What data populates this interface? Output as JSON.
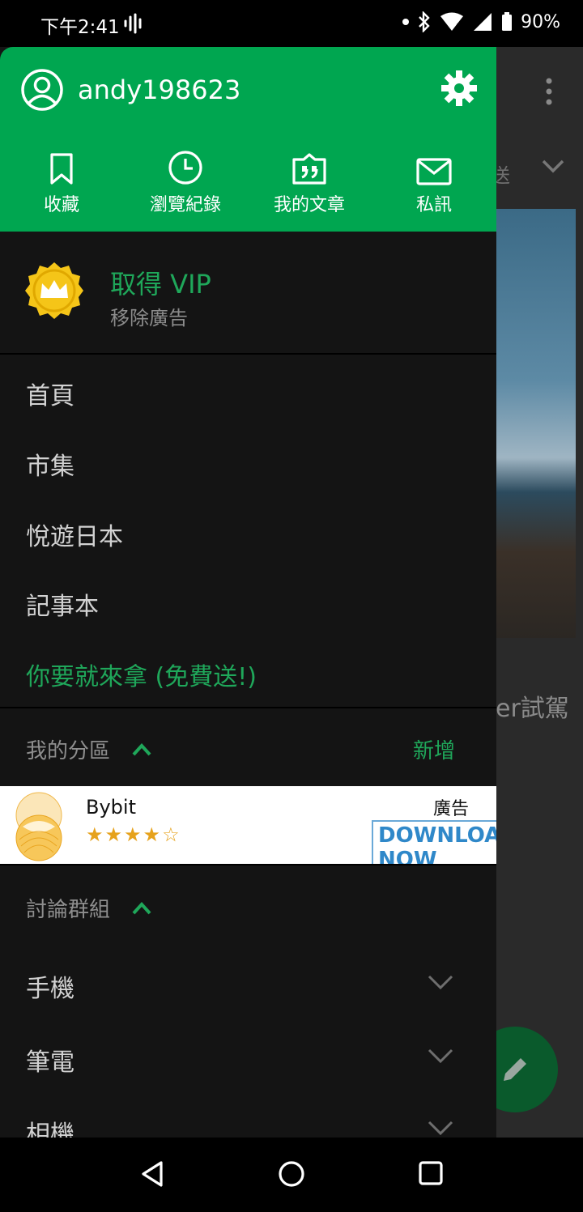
{
  "status_bar": {
    "time": "下午2:41",
    "battery": "90%"
  },
  "drawer": {
    "username": "andy198623",
    "quick_actions": [
      {
        "label": "收藏",
        "icon": "bookmark-icon"
      },
      {
        "label": "瀏覽紀錄",
        "icon": "clock-icon"
      },
      {
        "label": "我的文章",
        "icon": "quote-icon"
      },
      {
        "label": "私訊",
        "icon": "mail-icon"
      }
    ],
    "vip": {
      "title": "取得 VIP",
      "subtitle": "移除廣告"
    },
    "nav_items": [
      "首頁",
      "市集",
      "悅遊日本",
      "記事本",
      "你要就來拿 (免費送!)"
    ],
    "my_sections": {
      "label": "我的分區",
      "add": "新增"
    },
    "ad": {
      "title": "Bybit",
      "rating": 4,
      "stars": "★★★★☆",
      "tag": "廣告",
      "cta": "DOWNLOAD NOW"
    },
    "discussion_groups": {
      "label": "討論群組",
      "items": [
        "手機",
        "筆電",
        "相機"
      ]
    }
  },
  "background": {
    "text_fragment": "er試駕",
    "tab_fragment": "送"
  },
  "colors": {
    "accent": "#00a650",
    "drawer_bg": "#141414"
  }
}
